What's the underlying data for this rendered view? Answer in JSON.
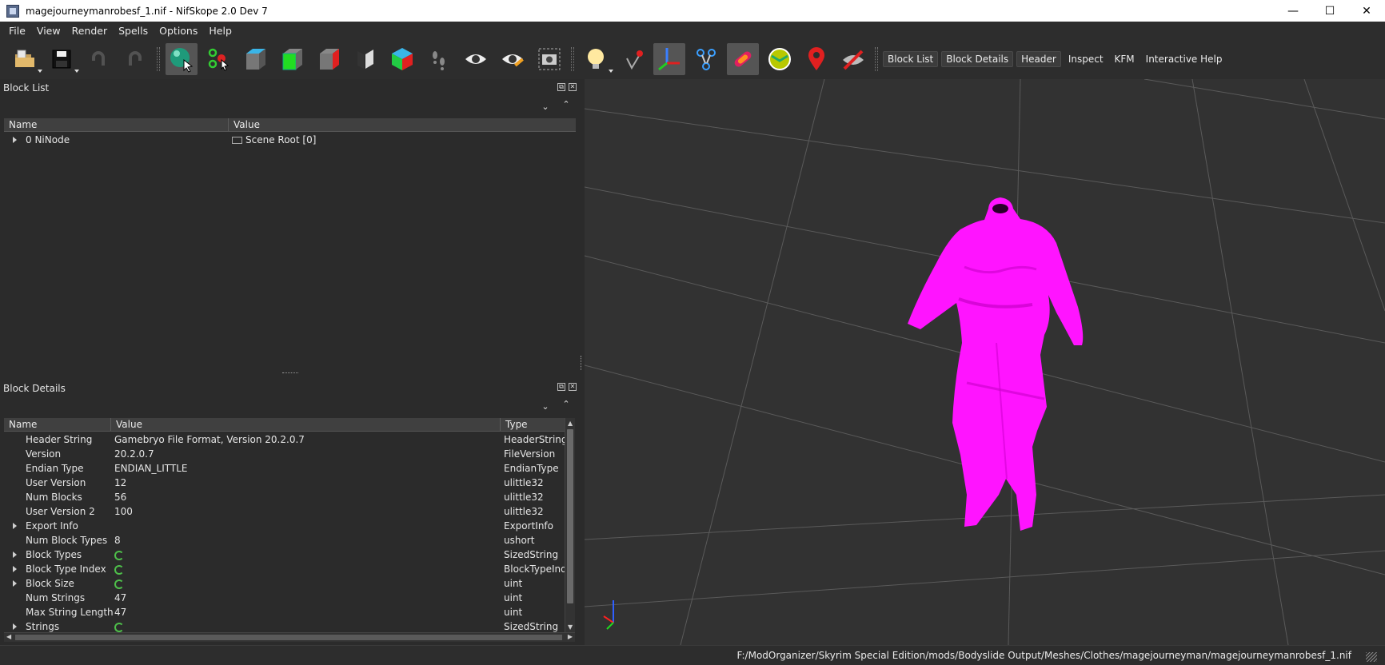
{
  "window": {
    "title": "magejourneymanrobesf_1.nif - NifSkope 2.0 Dev 7",
    "minimize": "—",
    "maximize": "☐",
    "close": "✕"
  },
  "menu": [
    "File",
    "View",
    "Render",
    "Spells",
    "Options",
    "Help"
  ],
  "toolbar": {
    "tabs": [
      {
        "label": "Block List",
        "boxed": true
      },
      {
        "label": "Block Details",
        "boxed": true
      },
      {
        "label": "Header",
        "boxed": true
      },
      {
        "label": "Inspect",
        "boxed": false
      },
      {
        "label": "KFM",
        "boxed": false
      },
      {
        "label": "Interactive Help",
        "boxed": false
      }
    ]
  },
  "block_list": {
    "title": "Block List",
    "columns": [
      "Name",
      "Value"
    ],
    "rows": [
      {
        "name": "0 NiNode",
        "value": "Scene Root [0]",
        "expandable": true
      }
    ]
  },
  "block_details": {
    "title": "Block Details",
    "columns": [
      "Name",
      "Value",
      "Type"
    ],
    "rows": [
      {
        "name": "Header String",
        "value": "Gamebryo File Format, Version 20.2.0.7",
        "type": "HeaderString",
        "expandable": false,
        "icon": false
      },
      {
        "name": "Version",
        "value": "20.2.0.7",
        "type": "FileVersion",
        "expandable": false,
        "icon": false
      },
      {
        "name": "Endian Type",
        "value": "ENDIAN_LITTLE",
        "type": "EndianType",
        "expandable": false,
        "icon": false
      },
      {
        "name": "User Version",
        "value": "12",
        "type": "ulittle32",
        "expandable": false,
        "icon": false
      },
      {
        "name": "Num Blocks",
        "value": "56",
        "type": "ulittle32",
        "expandable": false,
        "icon": false
      },
      {
        "name": "User Version 2",
        "value": "100",
        "type": "ulittle32",
        "expandable": false,
        "icon": false
      },
      {
        "name": "Export Info",
        "value": "",
        "type": "ExportInfo",
        "expandable": true,
        "icon": false
      },
      {
        "name": "Num Block Types",
        "value": "8",
        "type": "ushort",
        "expandable": false,
        "icon": false
      },
      {
        "name": "Block Types",
        "value": "",
        "type": "SizedString",
        "expandable": true,
        "icon": true
      },
      {
        "name": "Block Type Index",
        "value": "",
        "type": "BlockTypeInde",
        "expandable": true,
        "icon": true
      },
      {
        "name": "Block Size",
        "value": "",
        "type": "uint",
        "expandable": true,
        "icon": true
      },
      {
        "name": "Num Strings",
        "value": "47",
        "type": "uint",
        "expandable": false,
        "icon": false
      },
      {
        "name": "Max String Length",
        "value": "47",
        "type": "uint",
        "expandable": false,
        "icon": false
      },
      {
        "name": "Strings",
        "value": "",
        "type": "SizedString",
        "expandable": true,
        "icon": true
      }
    ]
  },
  "status": {
    "path": "F:/ModOrganizer/Skyrim Special Edition/mods/Bodyslide Output/Meshes/Clothes/magejourneyman/magejourneymanrobesf_1.nif"
  },
  "colors": {
    "mesh": "#ff14ff",
    "background": "#2b2b2b",
    "viewport": "#323232"
  }
}
